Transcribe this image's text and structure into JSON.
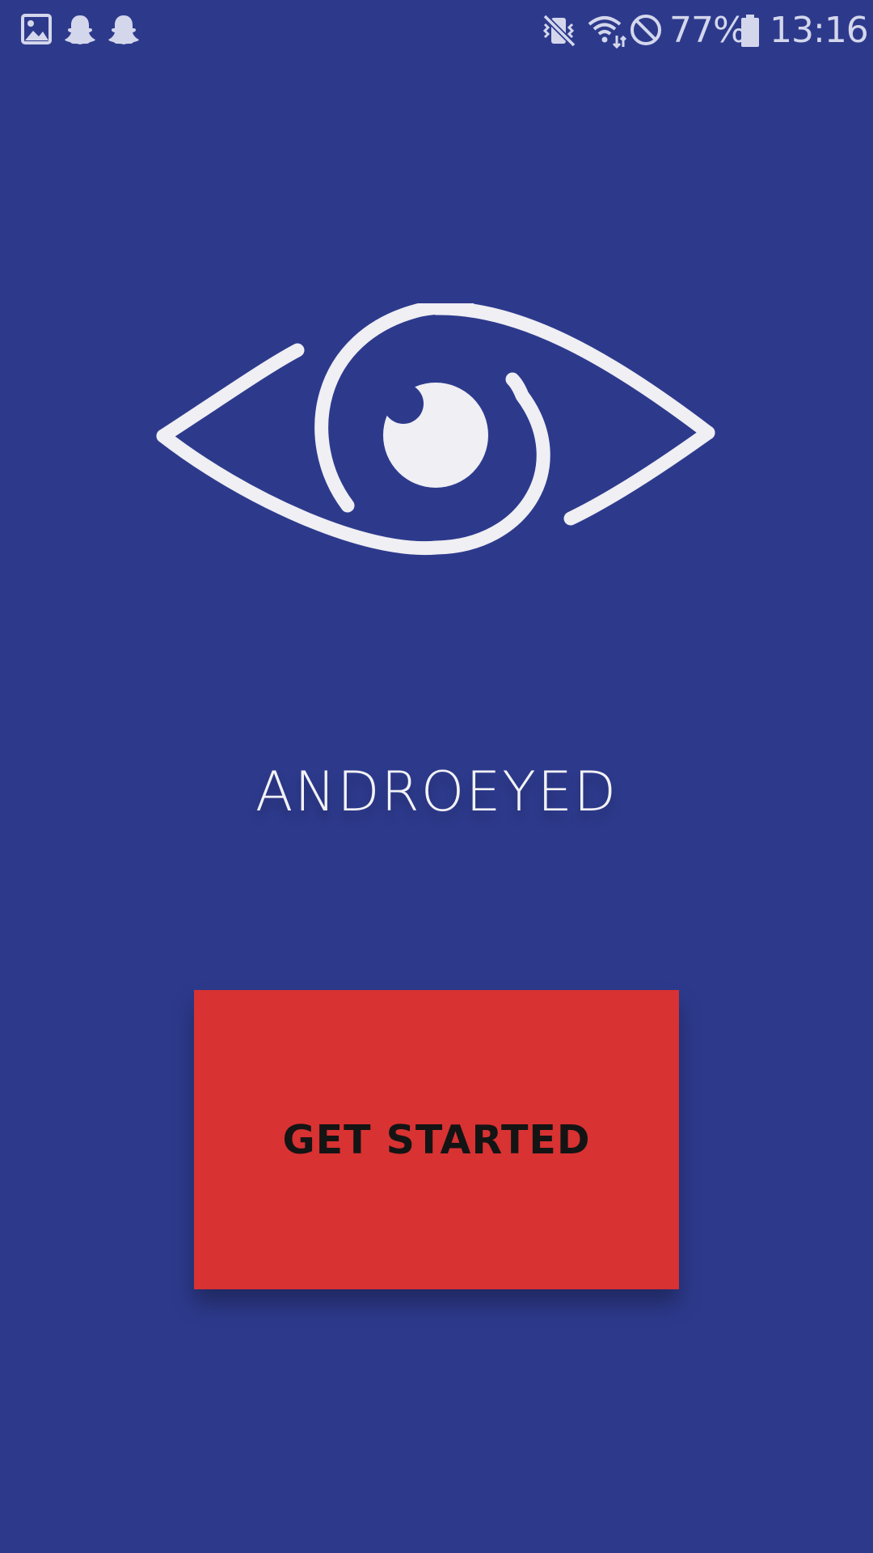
{
  "status_bar": {
    "left_icons": [
      "gallery-icon",
      "snapchat-icon",
      "snapchat-icon"
    ],
    "right_icons": [
      "vibrate-mute-icon",
      "wifi-icon",
      "do-not-disturb-icon",
      "battery-icon"
    ],
    "battery_percent": "77%",
    "time": "13:16",
    "icon_color": "#d4d7ec"
  },
  "app": {
    "logo_icon": "eye-icon",
    "title": "ANDROEYED",
    "cta_label": "GET STARTED"
  },
  "colors": {
    "background": "#2d3a8c",
    "logo": "#efeff4",
    "button": "#d83232",
    "button_text": "#141414"
  }
}
